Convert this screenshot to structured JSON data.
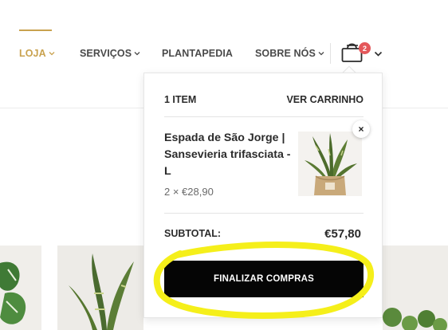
{
  "nav": {
    "items": [
      {
        "label": "LOJA",
        "has_dropdown": true,
        "active": true
      },
      {
        "label": "SERVIÇOS",
        "has_dropdown": true
      },
      {
        "label": "PLANTAPEDIA",
        "has_dropdown": false
      },
      {
        "label": "SOBRE NÓS",
        "has_dropdown": true
      }
    ],
    "cart": {
      "icon": "shopping-bag-icon",
      "badge_count": "2"
    }
  },
  "mini_cart": {
    "item_count_label": "1 ITEM",
    "view_cart_label": "VER CARRINHO",
    "items": [
      {
        "title": "Espada de São Jorge | Sansevieria trifasciata - L",
        "quantity_price": "2 × €28,90",
        "remove_label": "×"
      }
    ],
    "subtotal_label": "SUBTOTAL:",
    "subtotal_value": "€57,80",
    "checkout_label": "FINALIZAR COMPRAS"
  },
  "colors": {
    "accent": "#c9a24f",
    "badge": "#e4575a",
    "button": "#050505",
    "highlight": "#f5ef1a"
  }
}
